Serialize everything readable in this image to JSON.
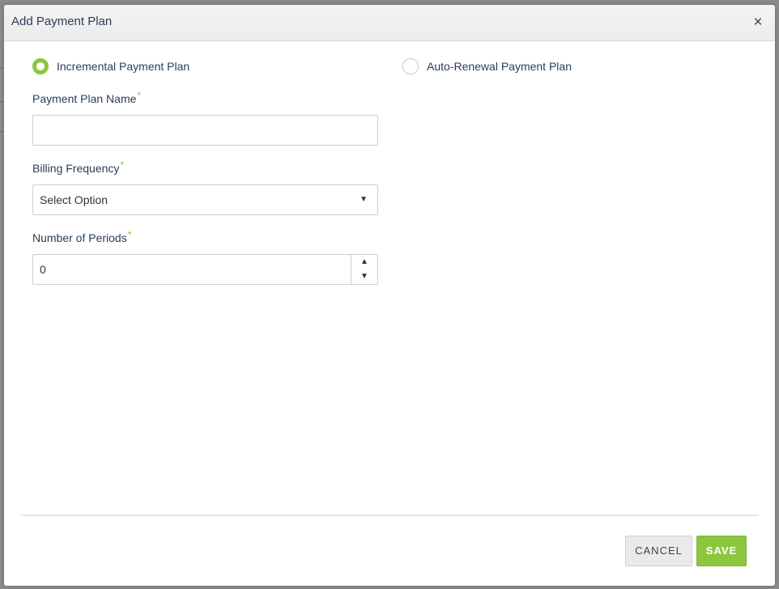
{
  "modal": {
    "title": "Add Payment Plan",
    "close_symbol": "×"
  },
  "plan_type": {
    "options": [
      {
        "label": "Incremental Payment Plan",
        "checked": true
      },
      {
        "label": "Auto-Renewal Payment Plan",
        "checked": false
      }
    ]
  },
  "fields": {
    "plan_name": {
      "label": "Payment Plan Name",
      "required_mark": "*",
      "value": "",
      "placeholder": ""
    },
    "billing_frequency": {
      "label": "Billing Frequency",
      "required_mark": "*",
      "selected": "Select Option"
    },
    "number_of_periods": {
      "label": "Number of Periods",
      "required_mark": "*",
      "value": "0"
    }
  },
  "footer": {
    "cancel_label": "CANCEL",
    "save_label": "SAVE"
  },
  "colors": {
    "accent_green": "#8cc63f",
    "title_text": "#2b3e55"
  },
  "icons": {
    "close": "close-icon",
    "select_caret": "caret-down-icon",
    "spin_up": "caret-up-icon",
    "spin_down": "caret-down-icon"
  }
}
